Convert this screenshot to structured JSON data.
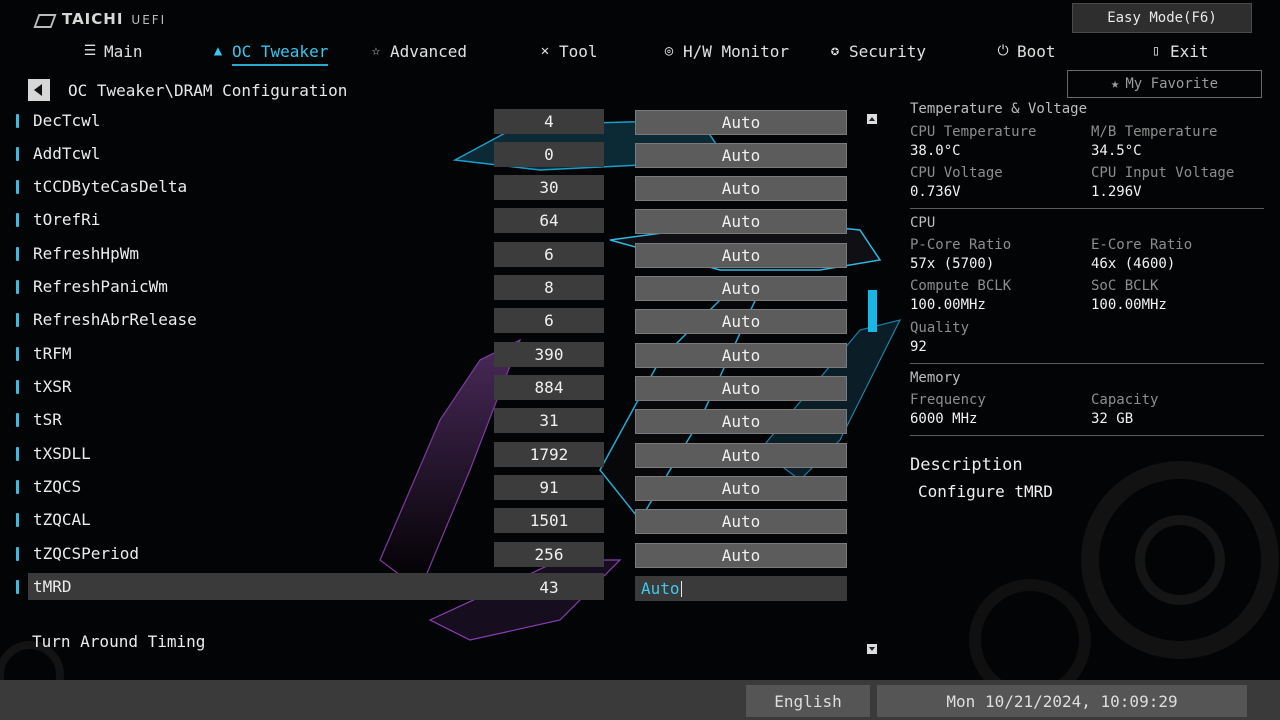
{
  "header": {
    "brand": "TAICHI",
    "brand_suffix": "UEFI",
    "easy_mode_label": "Easy Mode(F6)",
    "favorite_label": "My Favorite"
  },
  "nav": [
    {
      "label": "Main",
      "icon": "list-icon"
    },
    {
      "label": "OC Tweaker",
      "icon": "rocket-icon",
      "active": true
    },
    {
      "label": "Advanced",
      "icon": "star-icon"
    },
    {
      "label": "Tool",
      "icon": "wrench-icon"
    },
    {
      "label": "H/W Monitor",
      "icon": "monitor-icon"
    },
    {
      "label": "Security",
      "icon": "shield-icon"
    },
    {
      "label": "Boot",
      "icon": "power-icon"
    },
    {
      "label": "Exit",
      "icon": "exit-icon"
    }
  ],
  "breadcrumb": "OC Tweaker\\DRAM Configuration",
  "settings": [
    {
      "name": "DecTcwl",
      "value": "4",
      "option": "Auto"
    },
    {
      "name": "AddTcwl",
      "value": "0",
      "option": "Auto"
    },
    {
      "name": "tCCDByteCasDelta",
      "value": "30",
      "option": "Auto"
    },
    {
      "name": "tOrefRi",
      "value": "64",
      "option": "Auto"
    },
    {
      "name": "RefreshHpWm",
      "value": "6",
      "option": "Auto"
    },
    {
      "name": "RefreshPanicWm",
      "value": "8",
      "option": "Auto"
    },
    {
      "name": "RefreshAbrRelease",
      "value": "6",
      "option": "Auto"
    },
    {
      "name": "tRFM",
      "value": "390",
      "option": "Auto"
    },
    {
      "name": "tXSR",
      "value": "884",
      "option": "Auto"
    },
    {
      "name": "tSR",
      "value": "31",
      "option": "Auto"
    },
    {
      "name": "tXSDLL",
      "value": "1792",
      "option": "Auto"
    },
    {
      "name": "tZQCS",
      "value": "91",
      "option": "Auto"
    },
    {
      "name": "tZQCAL",
      "value": "1501",
      "option": "Auto"
    },
    {
      "name": "tZQCSPeriod",
      "value": "256",
      "option": "Auto"
    },
    {
      "name": "tMRD",
      "value": "43",
      "option": "Auto",
      "selected": true
    }
  ],
  "subheading": "Turn Around Timing",
  "panel": {
    "temp_voltage_title": "Temperature & Voltage",
    "cpu_temp_label": "CPU Temperature",
    "cpu_temp": "38.0°C",
    "mb_temp_label": "M/B Temperature",
    "mb_temp": "34.5°C",
    "cpu_voltage_label": "CPU Voltage",
    "cpu_voltage": "0.736V",
    "cpu_input_voltage_label": "CPU Input Voltage",
    "cpu_input_voltage": "1.296V",
    "cpu_title": "CPU",
    "pcore_label": "P-Core Ratio",
    "pcore": "57x (5700)",
    "ecore_label": "E-Core Ratio",
    "ecore": "46x (4600)",
    "compute_bclk_label": "Compute BCLK",
    "compute_bclk": "100.00MHz",
    "soc_bclk_label": "SoC BCLK",
    "soc_bclk": "100.00MHz",
    "quality_label": "Quality",
    "quality": "92",
    "memory_title": "Memory",
    "frequency_label": "Frequency",
    "frequency": "6000 MHz",
    "capacity_label": "Capacity",
    "capacity": "32 GB",
    "description_title": "Description",
    "description_text": "Configure tMRD"
  },
  "footer": {
    "language": "English",
    "datetime": "Mon 10/21/2024, 10:09:29"
  },
  "colors": {
    "accent": "#36c6ee",
    "scroll_thumb": "#19b7e8",
    "footer_bg": "#3a3a3a"
  }
}
